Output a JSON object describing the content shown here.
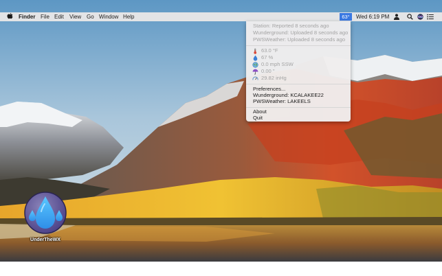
{
  "menubar": {
    "app_name": "Finder",
    "menus": [
      "File",
      "Edit",
      "View",
      "Go",
      "Window",
      "Help"
    ],
    "status_temp": "63°",
    "clock": "Wed 6:19 PM"
  },
  "dropdown": {
    "station": "Station: Reported 8 seconds ago",
    "wunderground_status": "Wunderground: Uploaded 8 seconds ago",
    "pwsweather_status": "PWSWeather: Uploaded 8 seconds ago",
    "temperature": "63.0 °F",
    "humidity": "67 %",
    "wind": "0.0 mph SSW",
    "rain": "0.00 \"",
    "pressure": "29.82 inHg",
    "preferences": "Preferences...",
    "wunderground_station": "Wunderground: KCALAKEE22",
    "pwsweather_station": "PWSWeather: LAKEELS",
    "about": "About",
    "quit": "Quit"
  },
  "desktop_icon": {
    "label": "UnderTheWX"
  }
}
